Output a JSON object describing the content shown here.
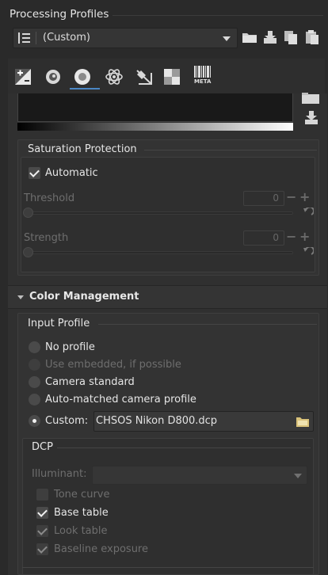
{
  "processing_profiles": {
    "title": "Processing Profiles",
    "selected_profile": "(Custom)"
  },
  "saturation_protection": {
    "title": "Saturation Protection",
    "automatic_label": "Automatic",
    "automatic_checked": true,
    "threshold_label": "Threshold",
    "threshold_value": "0",
    "strength_label": "Strength",
    "strength_value": "0"
  },
  "color_management": {
    "title": "Color Management"
  },
  "input_profile": {
    "title": "Input Profile",
    "options": {
      "no_profile": "No profile",
      "use_embedded": "Use embedded, if possible",
      "camera_standard": "Camera standard",
      "auto_matched": "Auto-matched camera profile",
      "custom": "Custom:"
    },
    "selected": "custom",
    "custom_profile_file": "CHSOS Nikon D800.dcp"
  },
  "dcp": {
    "title": "DCP",
    "illuminant_label": "Illuminant:",
    "tone_curve_label": "Tone curve",
    "base_table_label": "Base table",
    "look_table_label": "Look table",
    "baseline_exposure_label": "Baseline exposure"
  },
  "tabs": {
    "meta_label": "META"
  },
  "colors": {
    "accent": "#4a86c4",
    "folder_icon": "#d9c27a",
    "background": "#2a2a2a"
  }
}
